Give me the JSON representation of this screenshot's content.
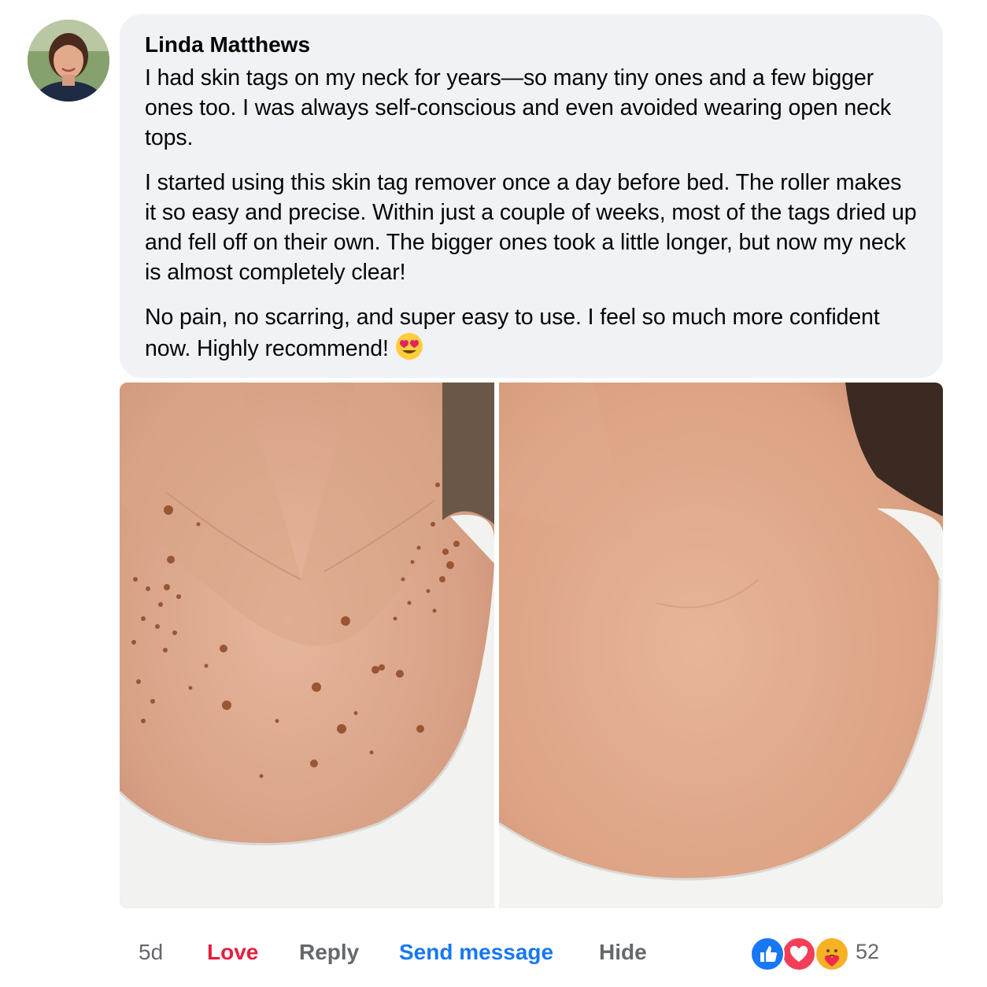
{
  "comment": {
    "author": "Linda Matthews",
    "paragraphs": [
      "I had skin tags on my neck for years—so many tiny ones and a few bigger ones too. I was always self-conscious and even avoided wearing open neck tops.",
      "I started using this skin tag remover once a day before bed. The roller makes it so easy and precise. Within just a couple of weeks, most of the tags dried up and fell off on their own. The bigger ones took a little longer, but now my neck is almost completely clear!",
      "No pain, no scarring, and super easy to use. I feel so much more confident now. Highly recommend!"
    ],
    "emoji": "heart-eyes-emoji"
  },
  "photos": [
    {
      "name": "before-photo",
      "icon": "neck-with-skin-tags-image"
    },
    {
      "name": "after-photo",
      "icon": "clear-neck-image"
    }
  ],
  "actions": {
    "time": "5d",
    "love": "Love",
    "reply": "Reply",
    "send_message": "Send message",
    "hide": "Hide"
  },
  "reactions": {
    "icons": [
      "like-icon",
      "love-icon",
      "care-icon"
    ],
    "count": "52"
  },
  "colors": {
    "bubble_bg": "#f0f2f5",
    "love": "#e41e3f",
    "link_blue": "#1877f2",
    "muted": "#65676b"
  }
}
